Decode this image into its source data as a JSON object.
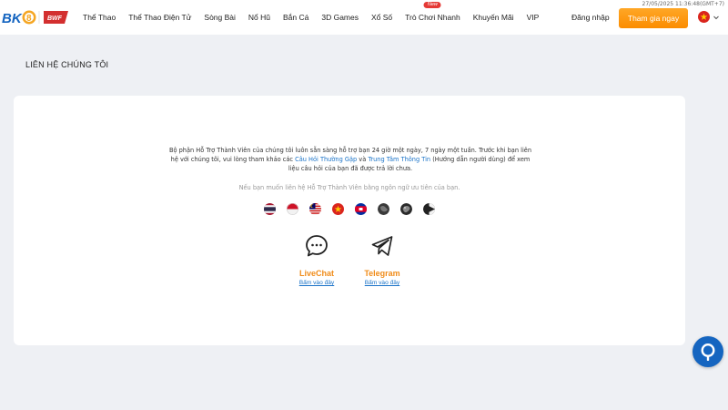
{
  "header": {
    "datetime": "27/05/2025 11:36:48(GMT+7)",
    "logo_text": "BK8",
    "partner_logo_text": "BWF",
    "nav": [
      {
        "label": "Thể Thao"
      },
      {
        "label": "Thể Thao Điện Tử"
      },
      {
        "label": "Sòng Bài"
      },
      {
        "label": "Nổ Hũ"
      },
      {
        "label": "Bắn Cá"
      },
      {
        "label": "3D Games"
      },
      {
        "label": "Xổ Số"
      },
      {
        "label": "Trò Chơi Nhanh",
        "badge": "New"
      },
      {
        "label": "Khuyến Mãi"
      },
      {
        "label": "VIP"
      }
    ],
    "login_label": "Đăng nhập",
    "signup_label": "Tham gia ngay",
    "language_flag_icon": "vietnam-flag-icon",
    "brand_color": "#fb8c00"
  },
  "page": {
    "title": "LIÊN HỆ CHÚNG TÔI"
  },
  "contact": {
    "intro_part1": "Bộ phận Hỗ Trợ Thành Viên của chúng tôi luôn sẵn sàng hỗ trợ bạn 24 giờ một ngày, 7 ngày một tuần. Trước khi bạn liên hệ với chúng tôi, vui lòng tham khảo các ",
    "faq_link": "Câu Hỏi Thường Gặp",
    "intro_and": " và ",
    "info_link": "Trung Tâm Thông Tin",
    "intro_part2": " (Hướng dẫn người dùng) để xem liệu câu hỏi của bạn đã được trả lời chưa.",
    "language_prompt": "Nếu bạn muốn liên hệ Hỗ Trợ Thành Viên bằng ngôn ngữ ưu tiên của bạn.",
    "language_flags": [
      "thailand-flag-icon",
      "indonesia-flag-icon",
      "malaysia-flag-icon",
      "vietnam-flag-icon",
      "cambodia-flag-icon",
      "globe-icon",
      "globe-icon",
      "myanmar-flag-icon"
    ],
    "channels": [
      {
        "name": "LiveChat",
        "link": "Bấm vào đây",
        "icon": "chat-bubble-icon"
      },
      {
        "name": "Telegram",
        "link": "Bấm vào đây",
        "icon": "telegram-icon"
      }
    ]
  }
}
